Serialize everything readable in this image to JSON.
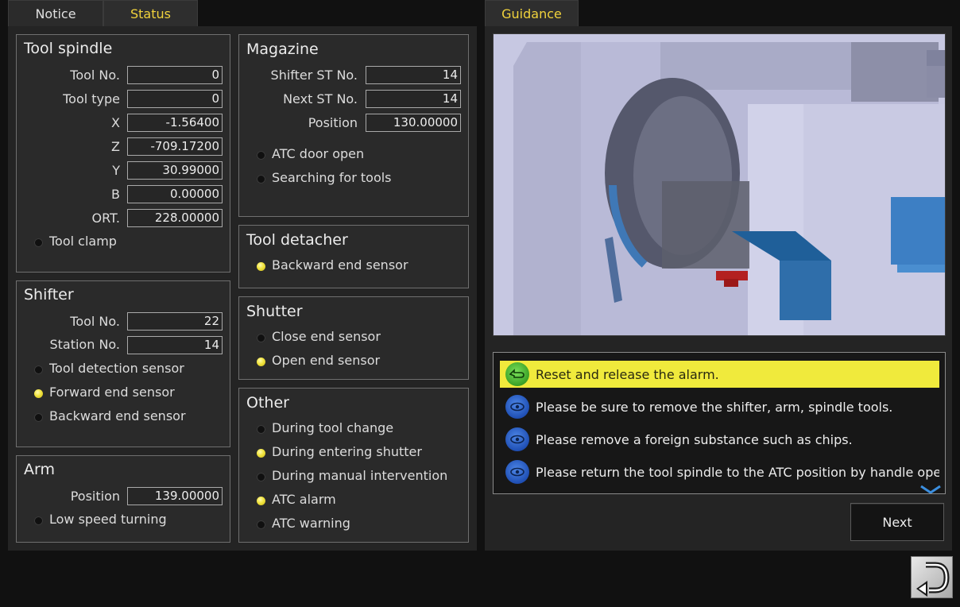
{
  "tabs": {
    "notice": "Notice",
    "status": "Status",
    "guidance": "Guidance"
  },
  "tool_spindle": {
    "title": "Tool spindle",
    "fields": [
      {
        "label": "Tool No.",
        "value": "0"
      },
      {
        "label": "Tool type",
        "value": "0"
      },
      {
        "label": "X",
        "value": "-1.56400"
      },
      {
        "label": "Z",
        "value": "-709.17200"
      },
      {
        "label": "Y",
        "value": "30.99000"
      },
      {
        "label": "B",
        "value": "0.00000"
      },
      {
        "label": "ORT.",
        "value": "228.00000"
      }
    ],
    "indicators": [
      {
        "label": "Tool clamp",
        "on": false
      }
    ]
  },
  "shifter": {
    "title": "Shifter",
    "fields": [
      {
        "label": "Tool No.",
        "value": "22"
      },
      {
        "label": "Station No.",
        "value": "14"
      }
    ],
    "indicators": [
      {
        "label": "Tool detection sensor",
        "on": false
      },
      {
        "label": "Forward end sensor",
        "on": true
      },
      {
        "label": "Backward end sensor",
        "on": false
      }
    ]
  },
  "arm": {
    "title": "Arm",
    "fields": [
      {
        "label": "Position",
        "value": "139.00000"
      }
    ],
    "indicators": [
      {
        "label": "Low speed turning",
        "on": false
      }
    ]
  },
  "magazine": {
    "title": "Magazine",
    "fields": [
      {
        "label": "Shifter ST No.",
        "value": "14"
      },
      {
        "label": "Next ST No.",
        "value": "14"
      },
      {
        "label": "Position",
        "value": "130.00000"
      }
    ],
    "indicators": [
      {
        "label": "ATC door open",
        "on": false
      },
      {
        "label": "Searching for tools",
        "on": false
      }
    ]
  },
  "tool_detacher": {
    "title": "Tool detacher",
    "indicators": [
      {
        "label": "Backward end sensor",
        "on": true
      }
    ]
  },
  "shutter": {
    "title": "Shutter",
    "indicators": [
      {
        "label": "Close end sensor",
        "on": false
      },
      {
        "label": "Open end sensor",
        "on": true
      }
    ]
  },
  "other": {
    "title": "Other",
    "indicators": [
      {
        "label": "During tool change",
        "on": false
      },
      {
        "label": "During entering shutter",
        "on": true
      },
      {
        "label": "During manual intervention",
        "on": false
      },
      {
        "label": "ATC alarm",
        "on": true
      },
      {
        "label": "ATC warning",
        "on": false
      }
    ]
  },
  "guidance": {
    "items": [
      {
        "text": "Reset and release the alarm.",
        "icon": "hand-pointer-icon",
        "highlight": true
      },
      {
        "text": "Please be sure to remove the shifter, arm, spindle tools.",
        "icon": "eye-icon",
        "highlight": false
      },
      {
        "text": "Please remove a foreign substance such as chips.",
        "icon": "eye-icon",
        "highlight": false
      },
      {
        "text": "Please return the tool spindle to the ATC position by handle opera",
        "icon": "eye-icon",
        "highlight": false
      }
    ],
    "next_label": "Next"
  },
  "colors": {
    "indicator_on": "#f1e43e",
    "active_tab_text": "#f0d23c",
    "highlight_row": "#f0ea3c"
  }
}
